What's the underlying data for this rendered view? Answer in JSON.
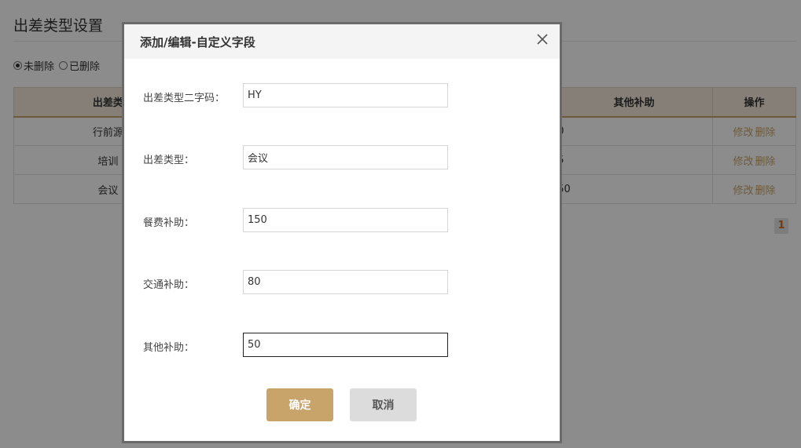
{
  "page": {
    "title": "出差类型设置",
    "filters": [
      {
        "label": "未删除",
        "checked": true
      },
      {
        "label": "已删除",
        "checked": false
      }
    ]
  },
  "table": {
    "headers": [
      "出差类",
      "其他补助",
      "操作"
    ],
    "rows": [
      {
        "name": "行前源",
        "other": "0",
        "edit": "修改",
        "delete": "删除"
      },
      {
        "name": "培训",
        "other": "5",
        "edit": "修改",
        "delete": "删除"
      },
      {
        "name": "会议",
        "other": "50",
        "edit": "修改",
        "delete": "删除"
      }
    ]
  },
  "pagination": {
    "current_page": "1"
  },
  "modal": {
    "title": "添加/编辑-自定义字段",
    "close_icon": "close-icon",
    "fields": [
      {
        "label": "出差类型二字码：",
        "value": "HY"
      },
      {
        "label": "出差类型：",
        "value": "会议"
      },
      {
        "label": "餐费补助：",
        "value": "150"
      },
      {
        "label": "交通补助：",
        "value": "80"
      },
      {
        "label": "其他补助：",
        "value": "50"
      }
    ],
    "ok_label": "确定",
    "cancel_label": "取消"
  },
  "colors": {
    "accent": "#c8a46a",
    "table_header_bg": "#f2e8da",
    "overlay": "rgba(0,0,0,0.45)",
    "pager_text": "#d2691e"
  }
}
